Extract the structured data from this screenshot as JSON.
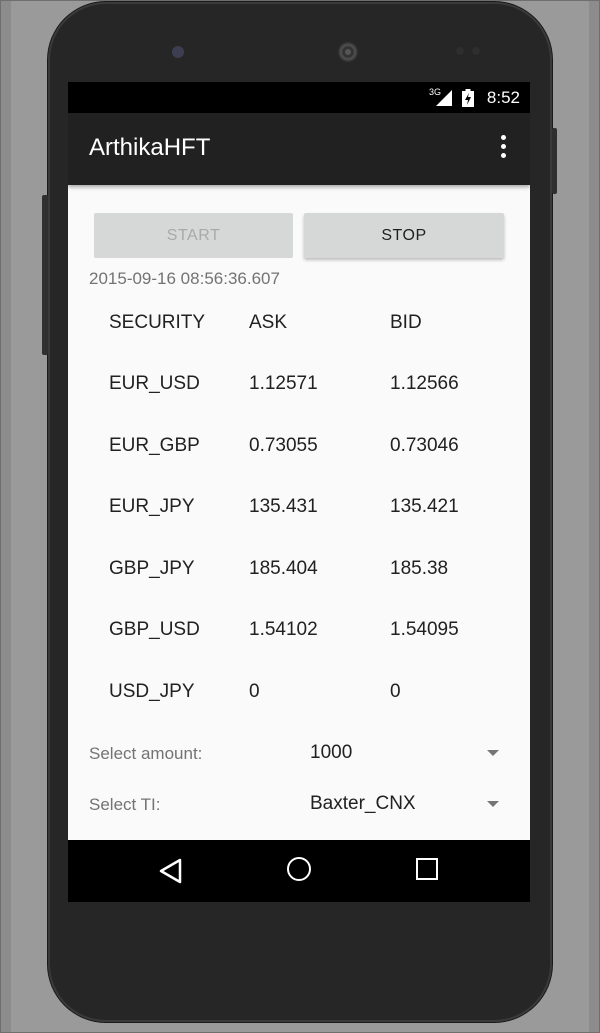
{
  "status": {
    "network": "3G",
    "time": "8:52"
  },
  "app": {
    "title": "ArthikaHFT"
  },
  "controls": {
    "start_label": "START",
    "stop_label": "STOP"
  },
  "timestamp": "2015-09-16 08:56:36.607",
  "table": {
    "headers": [
      "SECURITY",
      "ASK",
      "BID"
    ],
    "rows": [
      [
        "EUR_USD",
        "1.12571",
        "1.12566"
      ],
      [
        "EUR_GBP",
        "0.73055",
        "0.73046"
      ],
      [
        "EUR_JPY",
        "135.431",
        "135.421"
      ],
      [
        "GBP_JPY",
        "185.404",
        "185.38"
      ],
      [
        "GBP_USD",
        "1.54102",
        "1.54095"
      ],
      [
        "USD_JPY",
        "0",
        "0"
      ]
    ]
  },
  "amount": {
    "label": "Select amount:",
    "value": "1000"
  },
  "ti": {
    "label": "Select TI:",
    "value": "Baxter_CNX"
  },
  "icons": {
    "overflow": "more-vert-icon",
    "back": "back-triangle-icon",
    "home": "home-circle-icon",
    "recents": "recents-square-icon"
  }
}
